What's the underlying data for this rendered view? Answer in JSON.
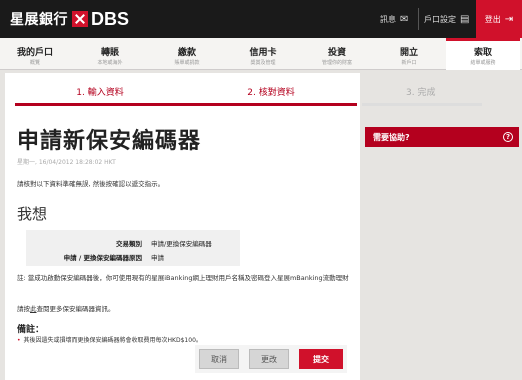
{
  "brand": {
    "name_cn": "星展銀行",
    "name_en": "DBS"
  },
  "topbar": {
    "messages": "訊息",
    "settings": "戶口設定",
    "logout": "登出"
  },
  "nav": [
    {
      "label": "我的戶口",
      "sub": "概覽"
    },
    {
      "label": "轉賬",
      "sub": "本地或海外"
    },
    {
      "label": "繳款",
      "sub": "賬單或捐款"
    },
    {
      "label": "信用卡",
      "sub": "獎賞及管理"
    },
    {
      "label": "投資",
      "sub": "管理你的財富"
    },
    {
      "label": "開立",
      "sub": "新戶口"
    },
    {
      "label": "索取",
      "sub": "結單或服務"
    }
  ],
  "steps": [
    "1. 輸入資料",
    "2. 核對資料",
    "3. 完成"
  ],
  "page": {
    "title": "申請新保安編碼器",
    "timestamp": "星期一, 16/04/2012 18:28:02 HKT",
    "hint": "請核對以下資料準確無誤, 然後按確認以遞交指示。",
    "section": "我想"
  },
  "details": [
    {
      "key": "交易類別",
      "value": "申請/更換保安編碼器"
    },
    {
      "key": "申請 / 更換保安編碼器原因",
      "value": "申請"
    }
  ],
  "note": "註: 當成功啟動保安編碼器後，你可使用現有的星展iBanking網上理財用戶名稱及密碼登入星展mBanking流動理財",
  "more": {
    "prefix": "請按",
    "link": "此",
    "suffix": "查閱更多保安編碼器資訊。"
  },
  "remarks": {
    "heading": "備註：",
    "items": [
      "其後因遺失或損壞而更換保安編碼器將會收取費用每次HKD$100。"
    ]
  },
  "buttons": {
    "cancel": "取消",
    "modify": "更改",
    "submit": "提交"
  },
  "help": {
    "label": "需要協助?",
    "icon": "question-icon"
  },
  "colors": {
    "accent": "#d0112b",
    "topbar": "#1a1a1a"
  }
}
